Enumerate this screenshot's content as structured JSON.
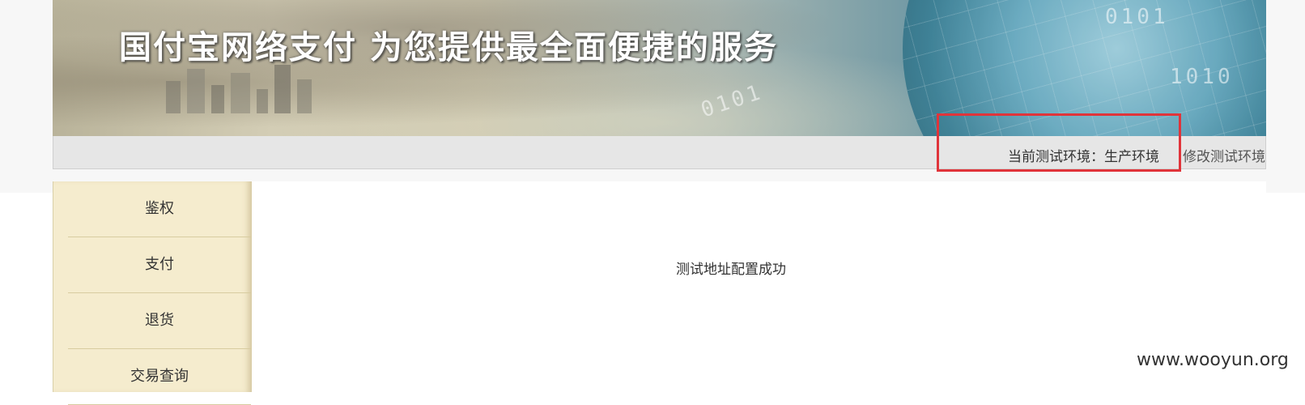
{
  "banner": {
    "title": "国付宝网络支付  为您提供最全面便捷的服务",
    "decor_binary_1": "0101",
    "decor_binary_2": "1010",
    "decor_binary_3": "0101"
  },
  "env_bar": {
    "current_env": "当前测试环境：生产环境",
    "edit_env": "修改测试环境"
  },
  "sidebar": {
    "items": [
      {
        "label": "鉴权"
      },
      {
        "label": "支付"
      },
      {
        "label": "退货"
      },
      {
        "label": "交易查询"
      }
    ]
  },
  "main": {
    "message": "测试地址配置成功"
  },
  "watermark": "www.wooyun.org",
  "colors": {
    "highlight": "#e0343a",
    "sidebar_bg": "#f5ecce",
    "env_bar_bg": "#e6e6e6"
  }
}
